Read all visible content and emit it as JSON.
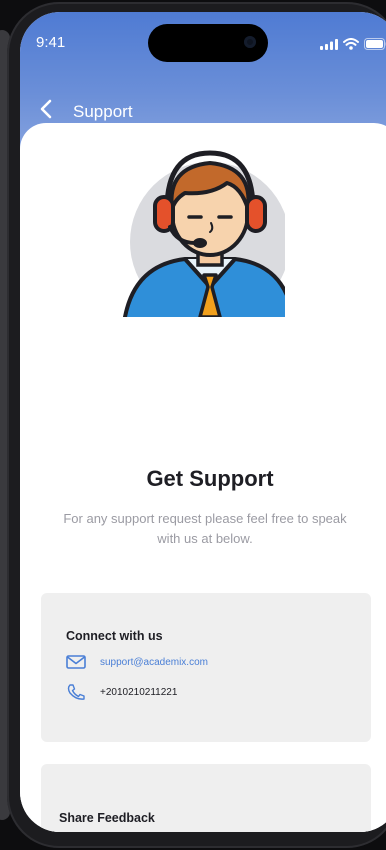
{
  "status_bar": {
    "time": "9:41",
    "icons": [
      "signal-icon",
      "wifi-icon",
      "battery-icon"
    ]
  },
  "header": {
    "back_icon": "chevron-left-icon",
    "title": "Support"
  },
  "hero": {
    "illustration": "support-agent-illustration",
    "title": "Get Support",
    "subtitle": "For any support request please feel free to speak with us at below."
  },
  "connect": {
    "title": "Connect with us",
    "email": "support@academix.com",
    "email_icon": "mail-icon",
    "phone": "+2010210211221",
    "phone_icon": "phone-icon"
  },
  "feedback": {
    "title": "Share Feedback"
  },
  "colors": {
    "header_gradient_top": "#4f7bd3",
    "accent": "#4a7fd6",
    "panel_bg": "#efefef"
  }
}
